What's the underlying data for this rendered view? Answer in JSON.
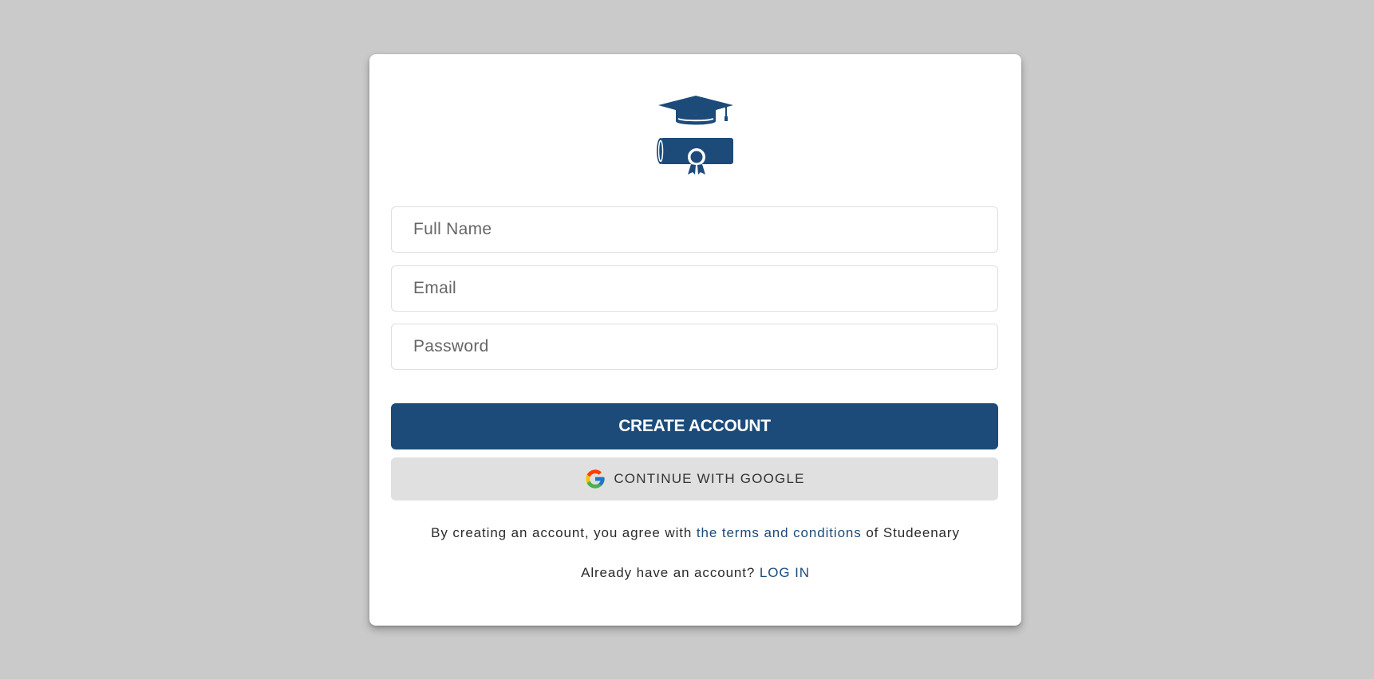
{
  "form": {
    "full_name_placeholder": "Full Name",
    "email_placeholder": "Email",
    "password_placeholder": "Password"
  },
  "buttons": {
    "create_account": "CREATE ACCOUNT",
    "continue_google": "CONTINUE WITH GOOGLE"
  },
  "terms": {
    "prefix": "By creating an account, you agree with ",
    "link": "the terms and conditions",
    "suffix": " of Studeenary"
  },
  "login": {
    "prompt": "Already have an account? ",
    "link": "LOG IN"
  },
  "icons": {
    "logo": "graduation-cap-diploma-icon",
    "google": "google-g-icon"
  },
  "colors": {
    "brand": "#1c4b7a",
    "page_background": "#cacaca",
    "google_button": "#e0e0e0"
  }
}
